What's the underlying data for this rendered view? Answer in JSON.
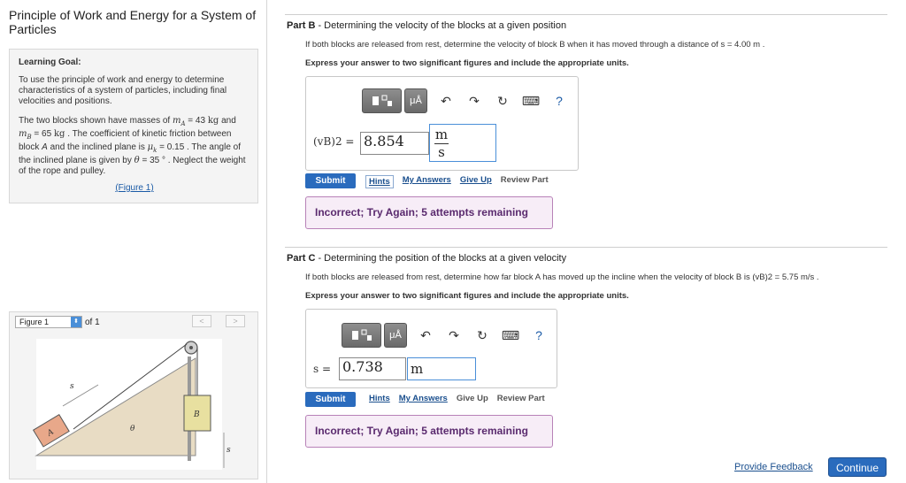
{
  "left": {
    "title": "Principle of Work and Energy for a System of Particles",
    "goal": {
      "heading": "Learning Goal:",
      "p1": "To use the principle of work and energy to determine characteristics of a system of particles, including final velocities and positions.",
      "p2_parts": {
        "a": "The two blocks shown have masses of ",
        "mA_sym": "m",
        "mA_sub": "A",
        "mA_val": " = 43 ",
        "mA_unit": "kg",
        "b": " and ",
        "mB_sym": "m",
        "mB_sub": "B",
        "mB_val": " = 65 ",
        "mB_unit": "kg",
        "c": " . The coefficient of kinetic friction between block ",
        "blockA": "A",
        "d": " and the inclined plane is ",
        "mu_sym": "μ",
        "mu_sub": "k",
        "mu_val": " = 0.15 .",
        "e": " The angle of the inclined plane is given by ",
        "theta_sym": "θ",
        "theta_val": " = 35 ° .",
        "f": " Neglect the weight of the rope and pulley."
      },
      "figure_link": "(Figure 1)"
    },
    "figure": {
      "selector": "Figure 1",
      "of_label": "of 1",
      "prev": "<",
      "next": ">",
      "labels": {
        "block_a": "A",
        "block_b": "B",
        "s_left": "s",
        "s_right": "s",
        "theta": "θ"
      }
    }
  },
  "partB": {
    "prefix": "Part B",
    "title": " - Determining the velocity of the blocks at a given position",
    "question": "If both blocks are released from rest, determine the velocity of block B when it has moved through a distance of s = 4.00  m .",
    "instruction": "Express your answer to two significant figures and include the appropriate units.",
    "toolbar": {
      "mu_label": "μÅ",
      "help": "?"
    },
    "eq_label": "(vB)2 =",
    "value": "8.854",
    "unit_num": "m",
    "unit_den": "s",
    "submit": "Submit",
    "links": {
      "hints": "Hints",
      "my_answers": "My Answers",
      "give_up": "Give Up",
      "review": "Review Part"
    },
    "feedback": "Incorrect; Try Again; 5 attempts remaining"
  },
  "partC": {
    "prefix": "Part C",
    "title": " - Determining the position of the blocks at a given velocity",
    "question": "If both blocks are released from rest, determine how far block A has moved up the incline when the velocity of block B is (vB)2 = 5.75  m/s .",
    "instruction": "Express your answer to two significant figures and include the appropriate units.",
    "toolbar": {
      "mu_label": "μÅ",
      "help": "?"
    },
    "eq_label": "s =",
    "value": "0.738",
    "unit": "m",
    "submit": "Submit",
    "links": {
      "hints": "Hints",
      "my_answers": "My Answers",
      "give_up": "Give Up",
      "review": "Review Part"
    },
    "feedback": "Incorrect; Try Again; 5 attempts remaining"
  },
  "footer": {
    "feedback": "Provide Feedback",
    "continue": "Continue"
  },
  "colors": {
    "accent": "#2a6bbd",
    "incorrect_bg": "#f7edf7",
    "incorrect_text": "#5a2a6e"
  },
  "icons": [
    "template-icon",
    "undo-icon",
    "redo-icon",
    "reset-icon",
    "keyboard-icon",
    "help-icon"
  ]
}
